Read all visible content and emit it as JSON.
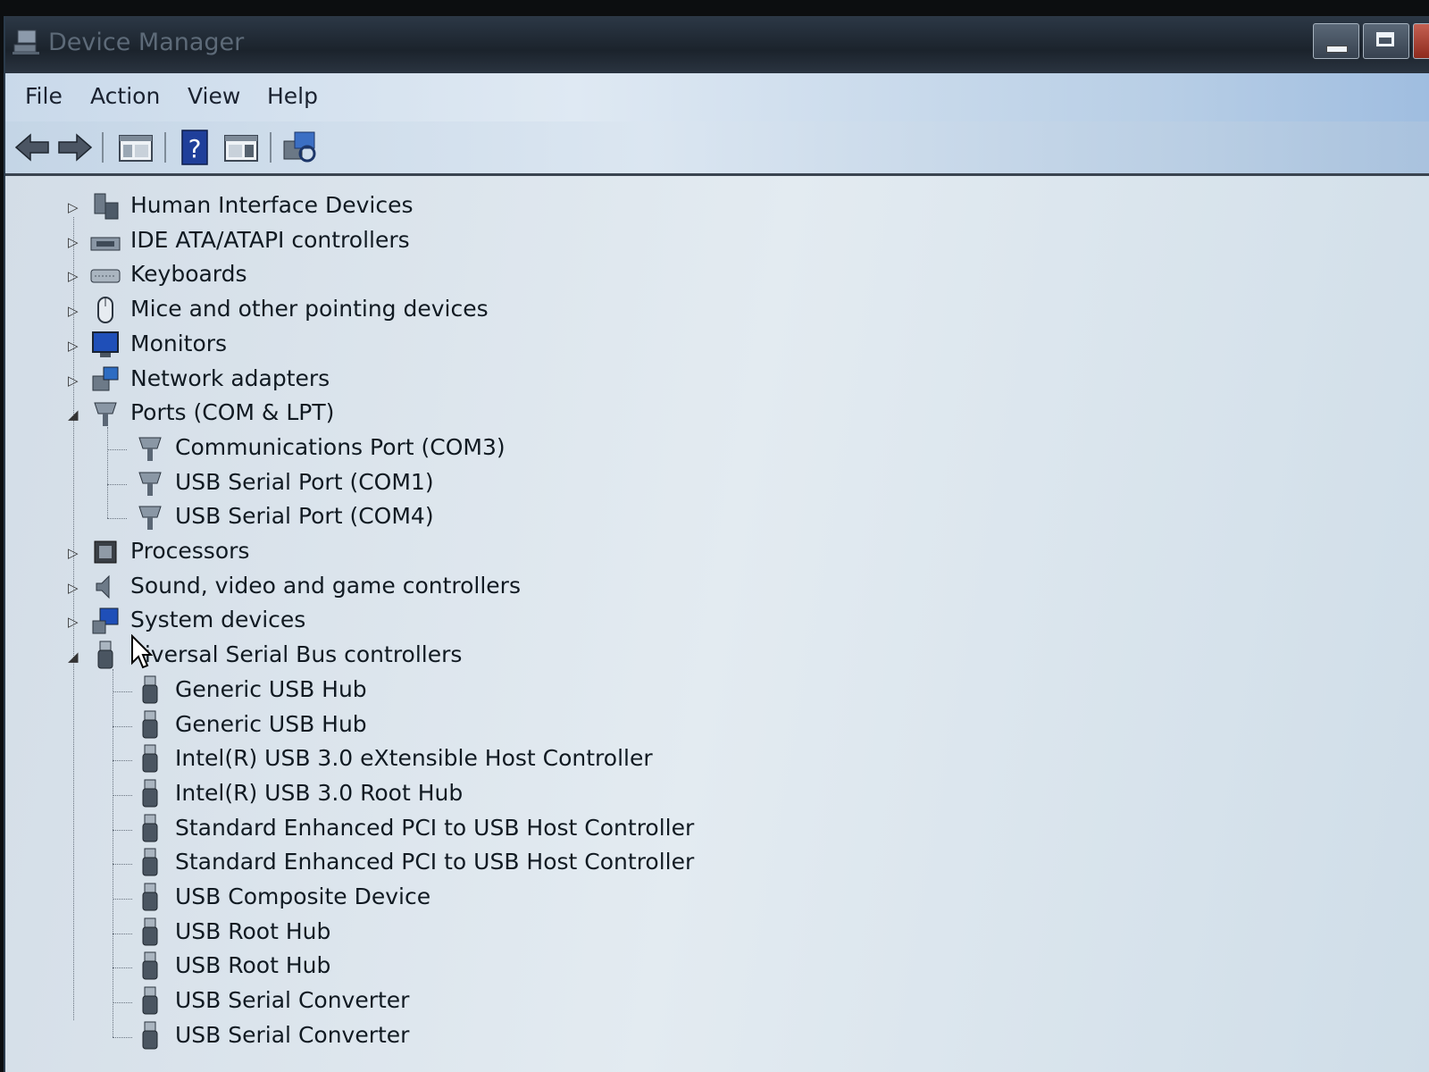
{
  "window": {
    "title": "Device Manager"
  },
  "menu": [
    "File",
    "Action",
    "View",
    "Help"
  ],
  "toolbar": {
    "buttons": [
      "back-arrow-icon",
      "forward-arrow-icon",
      "show-hide-console-tree-icon",
      "help-icon",
      "properties-icon",
      "scan-hardware-icon"
    ]
  },
  "tree": {
    "top_categories": [
      {
        "label": "Human Interface Devices",
        "icon": "hid-icon",
        "expanded": false
      },
      {
        "label": "IDE ATA/ATAPI controllers",
        "icon": "ide-controller-icon",
        "expanded": false
      },
      {
        "label": "Keyboards",
        "icon": "keyboard-icon",
        "expanded": false
      },
      {
        "label": "Mice and other pointing devices",
        "icon": "mouse-icon",
        "expanded": false
      },
      {
        "label": "Monitors",
        "icon": "monitor-icon",
        "expanded": false
      },
      {
        "label": "Network adapters",
        "icon": "network-adapter-icon",
        "expanded": false
      },
      {
        "label": "Ports (COM & LPT)",
        "icon": "port-icon",
        "expanded": true
      }
    ],
    "ports_children": [
      "Communications Port (COM3)",
      "USB Serial Port (COM1)",
      "USB Serial Port (COM4)"
    ],
    "mid_categories": [
      {
        "label": "Processors",
        "icon": "processor-icon",
        "expanded": false
      },
      {
        "label": "Sound, video and game controllers",
        "icon": "speaker-icon",
        "expanded": false
      },
      {
        "label": "System devices",
        "icon": "system-devices-icon",
        "expanded": false
      },
      {
        "label": "niversal Serial Bus controllers",
        "icon": "usb-icon",
        "expanded": true
      }
    ],
    "usb_children": [
      "Generic USB Hub",
      "Generic USB Hub",
      "Intel(R) USB 3.0 eXtensible Host Controller",
      "Intel(R) USB 3.0 Root Hub",
      "Standard Enhanced PCI to USB Host Controller",
      "Standard Enhanced PCI to USB Host Controller",
      "USB Composite Device",
      "USB Root Hub",
      "USB Root Hub",
      "USB Serial Converter",
      "USB Serial Converter"
    ]
  },
  "colors": {
    "titlebar": "#1b232c",
    "menubar": "#dfe9f3",
    "tree_background": "#e3ebf1",
    "text": "#111a22"
  }
}
